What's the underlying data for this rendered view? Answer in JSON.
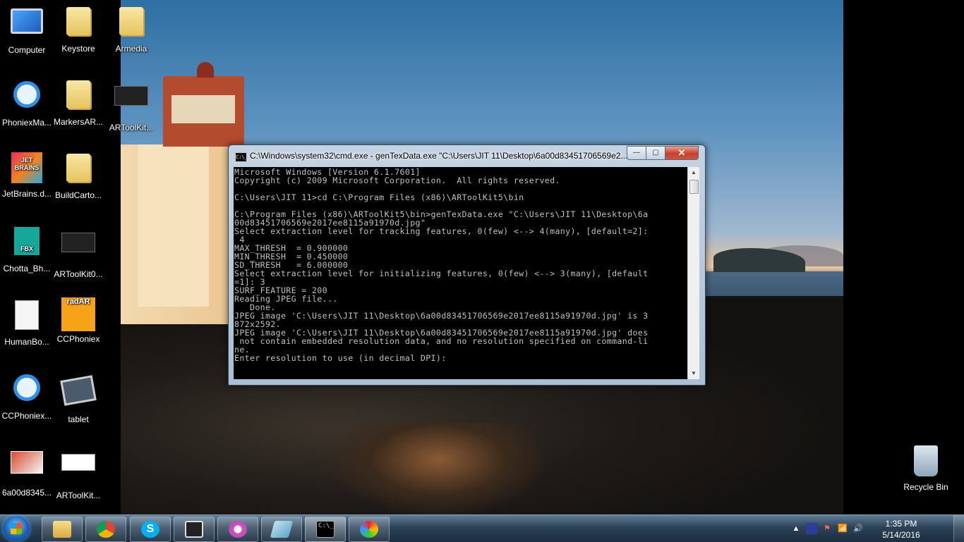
{
  "desktop": {
    "icons": [
      {
        "label": "Computer",
        "icon": "computer-icon"
      },
      {
        "label": "Keystore",
        "icon": "folder-icon"
      },
      {
        "label": "Armedia",
        "icon": "folder-icon"
      },
      {
        "label": "PhoniexMa...",
        "icon": "browser-shortcut-icon"
      },
      {
        "label": "MarkersAR...",
        "icon": "folder-icon"
      },
      {
        "label": "ARToolKit...",
        "icon": "app-shortcut-icon"
      },
      {
        "label": "JetBrains.d...",
        "icon": "jetbrains-icon"
      },
      {
        "label": "BuildCarto...",
        "icon": "folder-icon"
      },
      {
        "label": "Chotta_Bh...",
        "icon": "fbx-file-icon"
      },
      {
        "label": "ARToolKit0...",
        "icon": "app-shortcut-icon"
      },
      {
        "label": "HumanBo...",
        "icon": "document-icon"
      },
      {
        "label": "CCPhoniex",
        "icon": "radar-app-icon"
      },
      {
        "label": "CCPhoniex...",
        "icon": "browser-shortcut-icon"
      },
      {
        "label": "tablet",
        "icon": "tablet-icon"
      },
      {
        "label": "6a00d8345...",
        "icon": "image-file-icon"
      },
      {
        "label": "ARToolKit...",
        "icon": "app-shortcut-icon"
      }
    ],
    "recycle_bin": {
      "label": "Recycle Bin",
      "icon": "recycle-bin-icon"
    }
  },
  "cmd_window": {
    "title": "C:\\Windows\\system32\\cmd.exe - genTexData.exe  \"C:\\Users\\JIT 11\\Desktop\\6a00d83451706569e2...",
    "icon_text": "C:\\_",
    "minimize": "—",
    "maximize": "▢",
    "close": "✕",
    "console_lines": "Microsoft Windows [Version 6.1.7601]\nCopyright (c) 2009 Microsoft Corporation.  All rights reserved.\n\nC:\\Users\\JIT 11>cd C:\\Program Files (x86)\\ARToolKit5\\bin\n\nC:\\Program Files (x86)\\ARToolKit5\\bin>genTexData.exe \"C:\\Users\\JIT 11\\Desktop\\6a\n00d83451706569e2017ee8115a91970d.jpg\"\nSelect extraction level for tracking features, 0(few) <--> 4(many), [default=2]:\n 4\nMAX_THRESH  = 0.900000\nMIN_THRESH  = 0.450000\nSD_THRESH   = 6.000000\nSelect extraction level for initializing features, 0(few) <--> 3(many), [default\n=1]: 3\nSURF_FEATURE = 200\nReading JPEG file...\n   Done.\nJPEG image 'C:\\Users\\JIT 11\\Desktop\\6a00d83451706569e2017ee8115a91970d.jpg' is 3\n872x2592.\nJPEG image 'C:\\Users\\JIT 11\\Desktop\\6a00d83451706569e2017ee8115a91970d.jpg' does\n not contain embedded resolution data, and no resolution specified on command-li\nne.\nEnter resolution to use (in decimal DPI):"
  },
  "taskbar": {
    "pinned": [
      {
        "name": "windows-explorer",
        "icon": "explorer-icon"
      },
      {
        "name": "google-chrome",
        "icon": "chrome-icon"
      },
      {
        "name": "skype",
        "icon": "skype-icon",
        "glyph": "S"
      },
      {
        "name": "unity",
        "icon": "unity-icon"
      },
      {
        "name": "itunes",
        "icon": "itunes-icon"
      },
      {
        "name": "glass-app",
        "icon": "glass-app-icon"
      },
      {
        "name": "command-prompt",
        "icon": "cmd-icon",
        "glyph": "C:\\_"
      },
      {
        "name": "paint",
        "icon": "paint-icon"
      }
    ],
    "tray": {
      "show_hidden": "▲",
      "flag": "⚑",
      "network": "📶",
      "volume": "🔊"
    },
    "clock": {
      "time": "1:35 PM",
      "date": "5/14/2016"
    }
  }
}
